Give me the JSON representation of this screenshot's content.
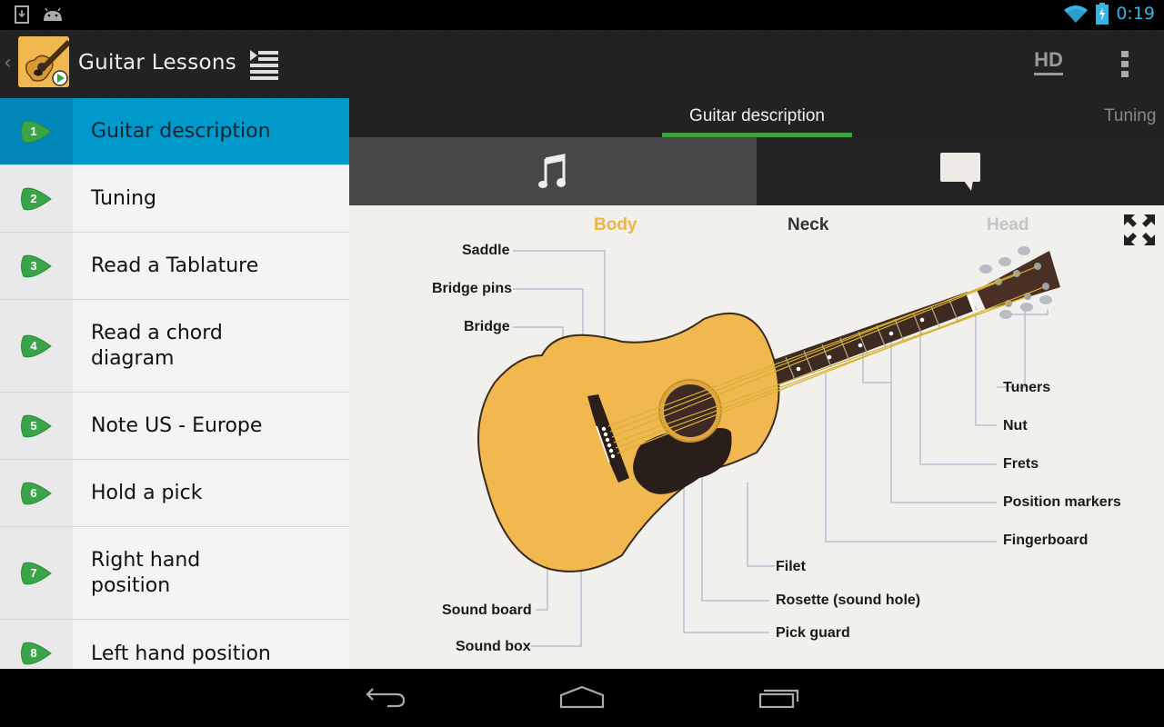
{
  "status_bar": {
    "left_icons": [
      "download-icon",
      "android-icon"
    ],
    "right_icons": [
      "wifi-icon",
      "battery-charging-icon"
    ],
    "time": "0:19",
    "accent_color": "#33b5e5"
  },
  "action_bar": {
    "title": "Guitar Lessons",
    "hd_label": "HD",
    "icons": [
      "up-caret-icon",
      "app-guitar-icon",
      "drawer-list-icon",
      "overflow-menu-icon"
    ]
  },
  "sidebar": {
    "active_color": "#0099cc",
    "badge_color": "#3aa548",
    "lessons": [
      {
        "number": "1",
        "label": "Guitar description",
        "active": true
      },
      {
        "number": "2",
        "label": "Tuning"
      },
      {
        "number": "3",
        "label": "Read a Tablature"
      },
      {
        "number": "4",
        "label": "Read a chord diagram"
      },
      {
        "number": "5",
        "label": "Note US - Europe"
      },
      {
        "number": "6",
        "label": "Hold a pick"
      },
      {
        "number": "7",
        "label": "Right hand position"
      },
      {
        "number": "8",
        "label": "Left hand position"
      }
    ]
  },
  "content": {
    "tabs": [
      {
        "label": "Guitar description",
        "active": true
      },
      {
        "label": "Tuning"
      }
    ],
    "indicator_color": "#3fa43f",
    "mode_buttons": [
      {
        "name": "music",
        "icon": "music-note-icon",
        "selected": true
      },
      {
        "name": "comment",
        "icon": "speech-bubble-icon",
        "selected": false
      }
    ],
    "diagram": {
      "sections": [
        {
          "label": "Body",
          "color": "#f0b24a"
        },
        {
          "label": "Neck",
          "color": "#333333"
        },
        {
          "label": "Head",
          "color": "#c4c4c4"
        }
      ],
      "parts_left": [
        "Saddle",
        "Bridge pins",
        "Bridge",
        "Sound board",
        "Sound box"
      ],
      "parts_right": [
        "Tuners",
        "Nut",
        "Frets",
        "Position markers",
        "Fingerboard"
      ],
      "parts_bottom": [
        "Filet",
        "Rosette (sound hole)",
        "Pick guard"
      ],
      "body_color": "#f1b84f",
      "fullscreen_icon": "expand-icon"
    }
  },
  "nav_bar": {
    "buttons": [
      "back-icon",
      "home-icon",
      "recent-apps-icon"
    ]
  }
}
